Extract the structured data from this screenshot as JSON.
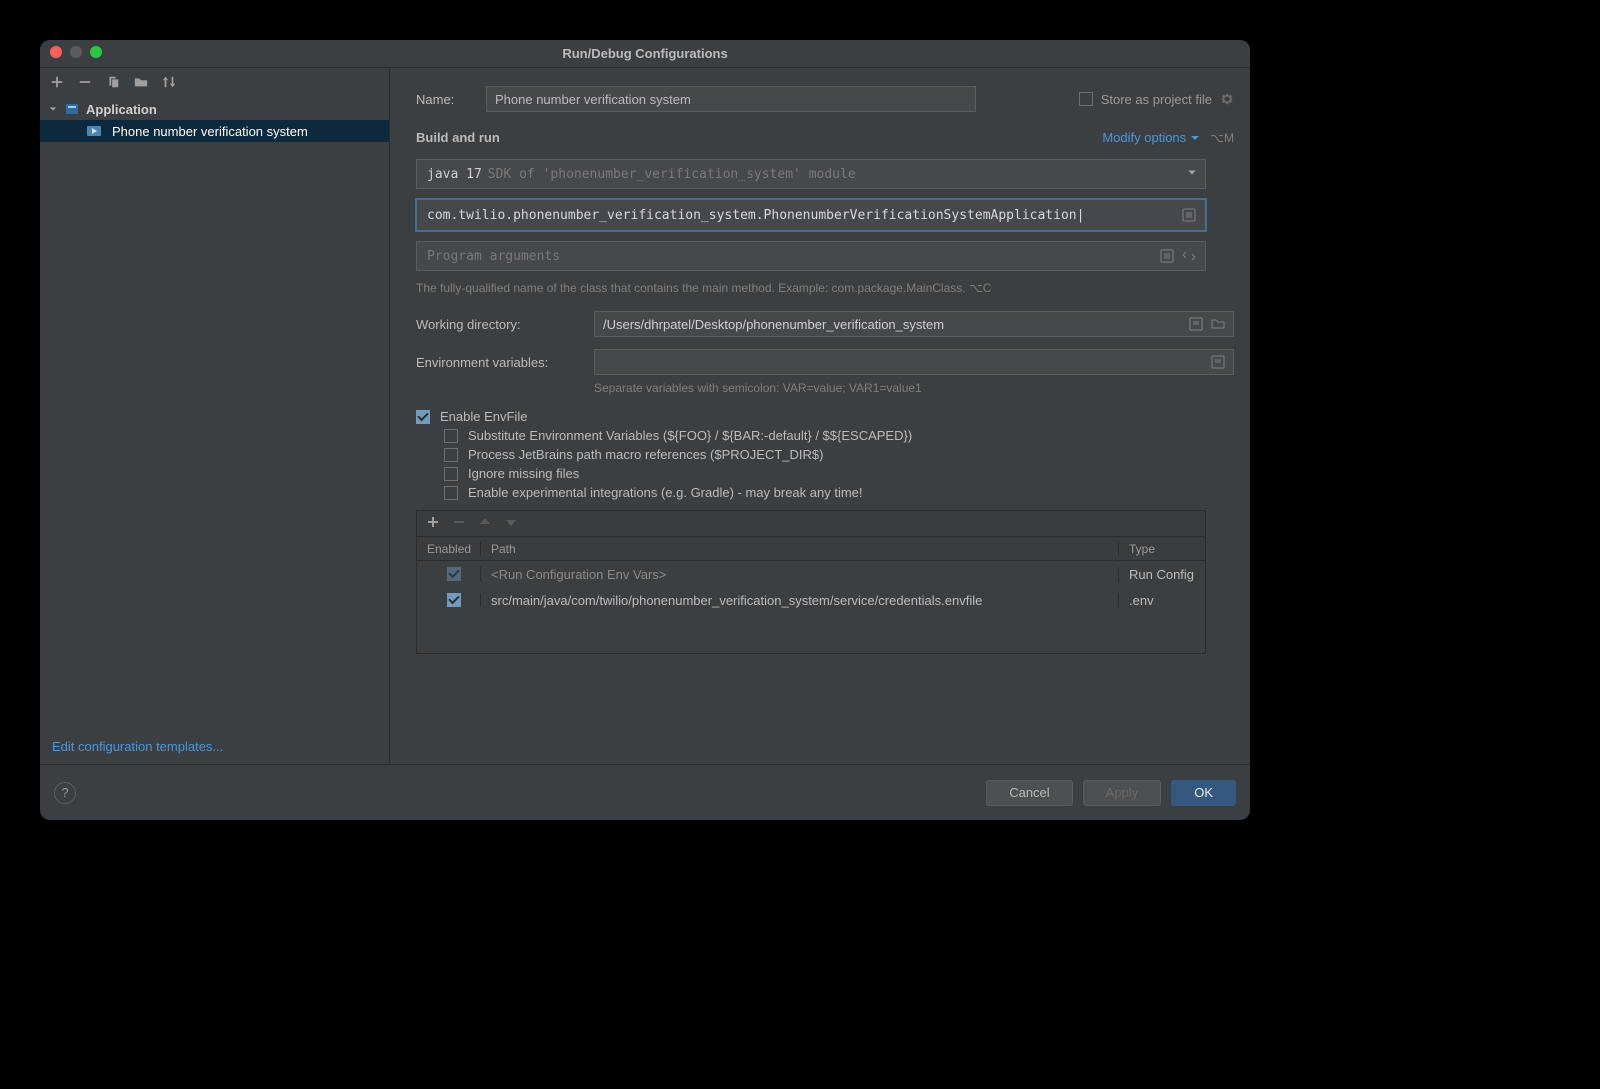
{
  "window": {
    "title": "Run/Debug Configurations"
  },
  "sidebar": {
    "root_label": "Application",
    "selected_item": "Phone number verification system",
    "footer_link": "Edit configuration templates..."
  },
  "form": {
    "name_label": "Name:",
    "name_value": "Phone number verification system",
    "store_label": "Store as project file",
    "section_build": "Build and run",
    "modify_label": "Modify options",
    "modify_shortcut": "⌥M",
    "sdk_primary": "java 17",
    "sdk_secondary": "SDK of 'phonenumber_verification_system' module",
    "main_class": "com.twilio.phonenumber_verification_system.PhonenumberVerificationSystemApplication",
    "args_placeholder": "Program arguments",
    "main_hint": "The fully-qualified name of the class that contains the main method. Example: com.package.MainClass.  ⌥C",
    "wd_label": "Working directory:",
    "wd_value": "/Users/dhrpatel/Desktop/phonenumber_verification_system",
    "env_label": "Environment variables:",
    "env_value": "",
    "env_hint": "Separate variables with semicolon: VAR=value; VAR1=value1",
    "envfile": {
      "enable": "Enable EnvFile",
      "sub1": "Substitute Environment Variables (${FOO} / ${BAR:-default} / $${ESCAPED})",
      "sub2": "Process JetBrains path macro references ($PROJECT_DIR$)",
      "sub3": "Ignore missing files",
      "sub4": "Enable experimental integrations (e.g. Gradle) - may break any time!"
    },
    "table": {
      "col_enabled": "Enabled",
      "col_path": "Path",
      "col_type": "Type",
      "rows": [
        {
          "path": "<Run Configuration Env Vars>",
          "type": "Run Config",
          "locked": true
        },
        {
          "path": "src/main/java/com/twilio/phonenumber_verification_system/service/credentials.envfile",
          "type": ".env",
          "locked": false
        }
      ]
    }
  },
  "footer": {
    "cancel": "Cancel",
    "apply": "Apply",
    "ok": "OK"
  }
}
